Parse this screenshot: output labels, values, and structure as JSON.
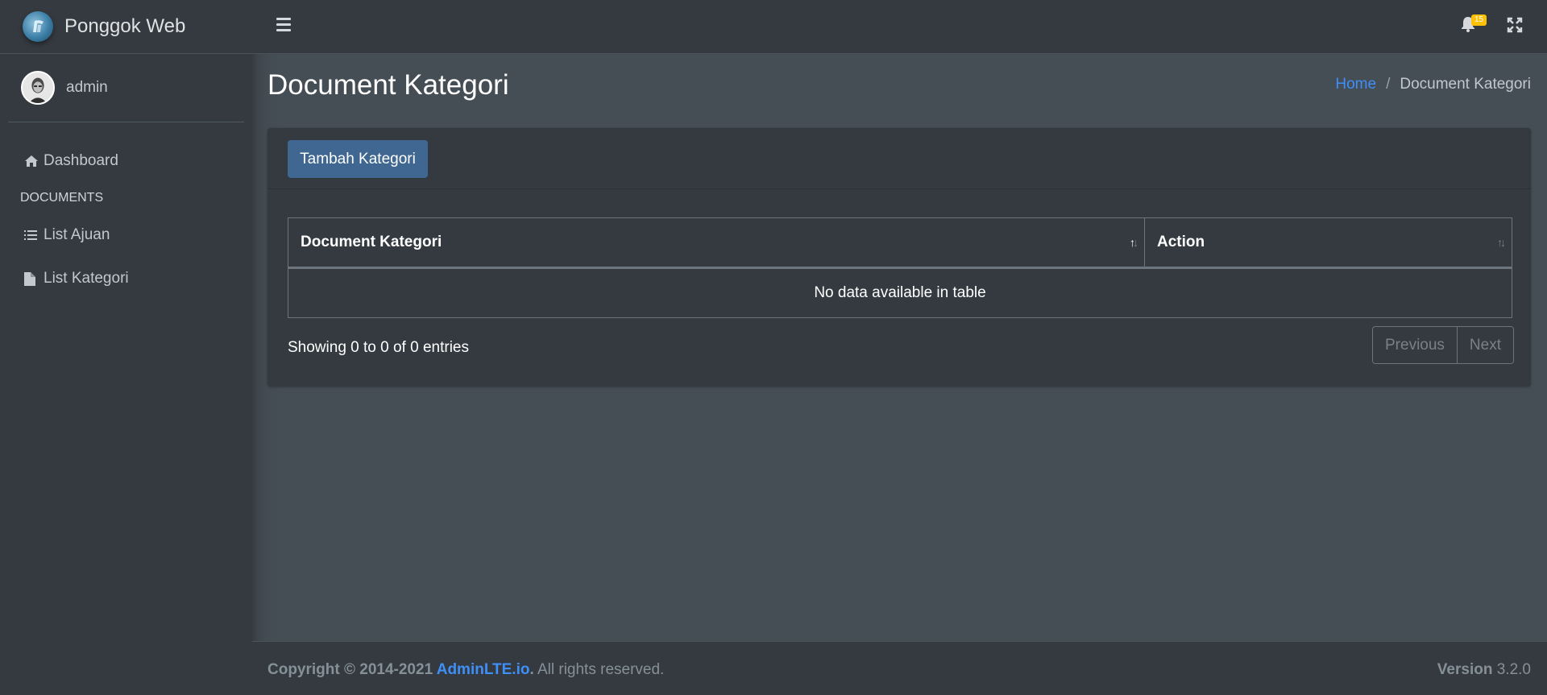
{
  "brand": {
    "name": "Ponggok Web"
  },
  "user": {
    "name": "admin"
  },
  "sidebar": {
    "items": [
      {
        "label": "Dashboard",
        "icon": "home-icon"
      },
      {
        "header": "DOCUMENTS"
      },
      {
        "label": "List Ajuan",
        "icon": "list-icon"
      },
      {
        "label": "List Kategori",
        "icon": "file-icon"
      }
    ]
  },
  "topbar": {
    "notification_count": "15"
  },
  "page": {
    "title": "Document Kategori",
    "breadcrumb": {
      "home": "Home",
      "separator": "/",
      "current": "Document Kategori"
    }
  },
  "card": {
    "add_button": "Tambah Kategori",
    "table": {
      "columns": [
        "Document Kategori",
        "Action"
      ],
      "empty_text": "No data available in table"
    },
    "info": "Showing 0 to 0 of 0 entries",
    "pagination": {
      "previous": "Previous",
      "next": "Next"
    }
  },
  "footer": {
    "copyright_prefix": "Copyright © 2014-2021 ",
    "link_text": "AdminLTE.io",
    "suffix_dot": ".",
    "rights": " All rights reserved.",
    "version_label": "Version",
    "version_value": " 3.2.0"
  },
  "colors": {
    "sidebar_bg": "#343a40",
    "content_bg": "#454d55",
    "primary_button": "#3f6791",
    "link": "#3f8ff7",
    "badge": "#ffc107"
  }
}
